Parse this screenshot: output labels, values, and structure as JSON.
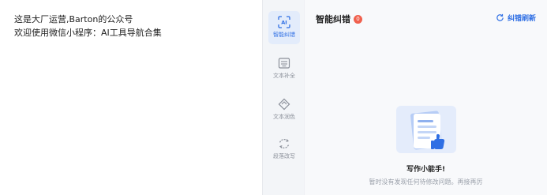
{
  "editor": {
    "lines": [
      "这是大厂运营,Barton的公众号",
      "欢迎使用微信小程序：AI工具导航合集"
    ]
  },
  "toolbar": {
    "items": [
      {
        "label": "智能纠错",
        "icon": "ai-scan-icon",
        "active": true
      },
      {
        "label": "文本补全",
        "icon": "keyboard-icon",
        "active": false
      },
      {
        "label": "文本润色",
        "icon": "diamond-icon",
        "active": false
      },
      {
        "label": "段落改写",
        "icon": "rewrite-icon",
        "active": false
      }
    ]
  },
  "panel": {
    "title": "智能纠错",
    "badge": "0",
    "refresh_label": "纠错刷新",
    "empty_title": "写作小能手!",
    "empty_subtitle": "暂时没有发现任何待修改问题。再接再厉"
  },
  "colors": {
    "accent": "#2f6fe4",
    "badge": "#f0604d",
    "active_tool_bg": "#e3ecfb"
  }
}
